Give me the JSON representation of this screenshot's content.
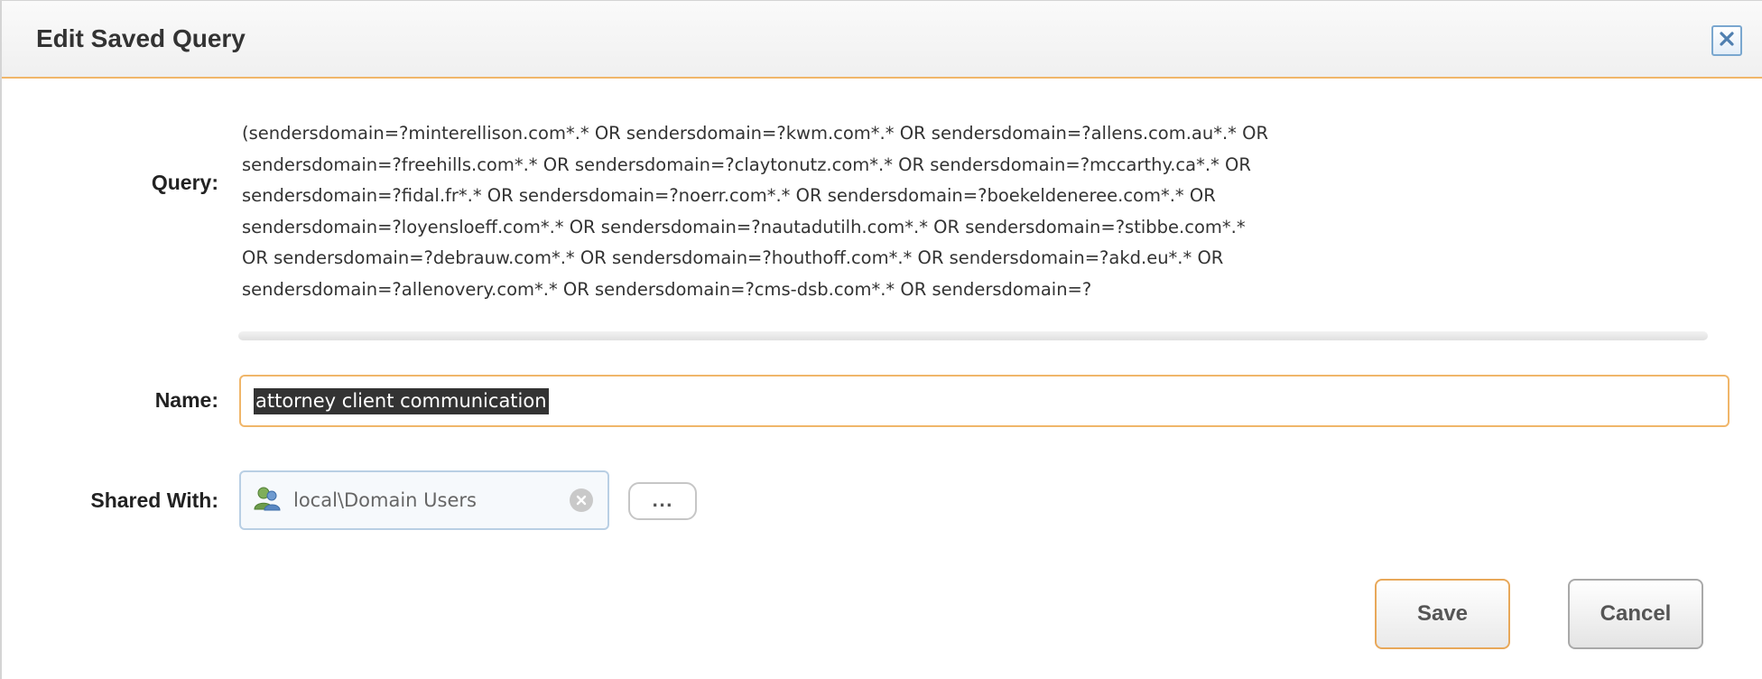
{
  "dialog": {
    "title": "Edit Saved Query",
    "close_icon": "close-icon"
  },
  "form": {
    "query_label": "Query:",
    "query_value": "(sendersdomain=?minterellison.com*.* OR sendersdomain=?kwm.com*.* OR sendersdomain=?allens.com.au*.* OR\nsendersdomain=?freehills.com*.* OR sendersdomain=?claytonutz.com*.* OR sendersdomain=?mccarthy.ca*.* OR\nsendersdomain=?fidal.fr*.* OR sendersdomain=?noerr.com*.* OR sendersdomain=?boekeldeneree.com*.* OR\nsendersdomain=?loyensloeff.com*.* OR sendersdomain=?nautadutilh.com*.* OR sendersdomain=?stibbe.com*.*\nOR sendersdomain=?debrauw.com*.* OR sendersdomain=?houthoff.com*.* OR sendersdomain=?akd.eu*.* OR\nsendersdomain=?allenovery.com*.* OR sendersdomain=?cms-dsb.com*.* OR sendersdomain=?",
    "name_label": "Name:",
    "name_value": "attorney client communication",
    "shared_label": "Shared With:",
    "shared_with": [
      {
        "label": "local\\Domain Users",
        "icon": "user-group-icon"
      }
    ],
    "more_label": "..."
  },
  "buttons": {
    "save": "Save",
    "cancel": "Cancel"
  },
  "colors": {
    "accent": "#f0b66a",
    "title_text": "#333333",
    "close_border": "#7aa7cf"
  }
}
